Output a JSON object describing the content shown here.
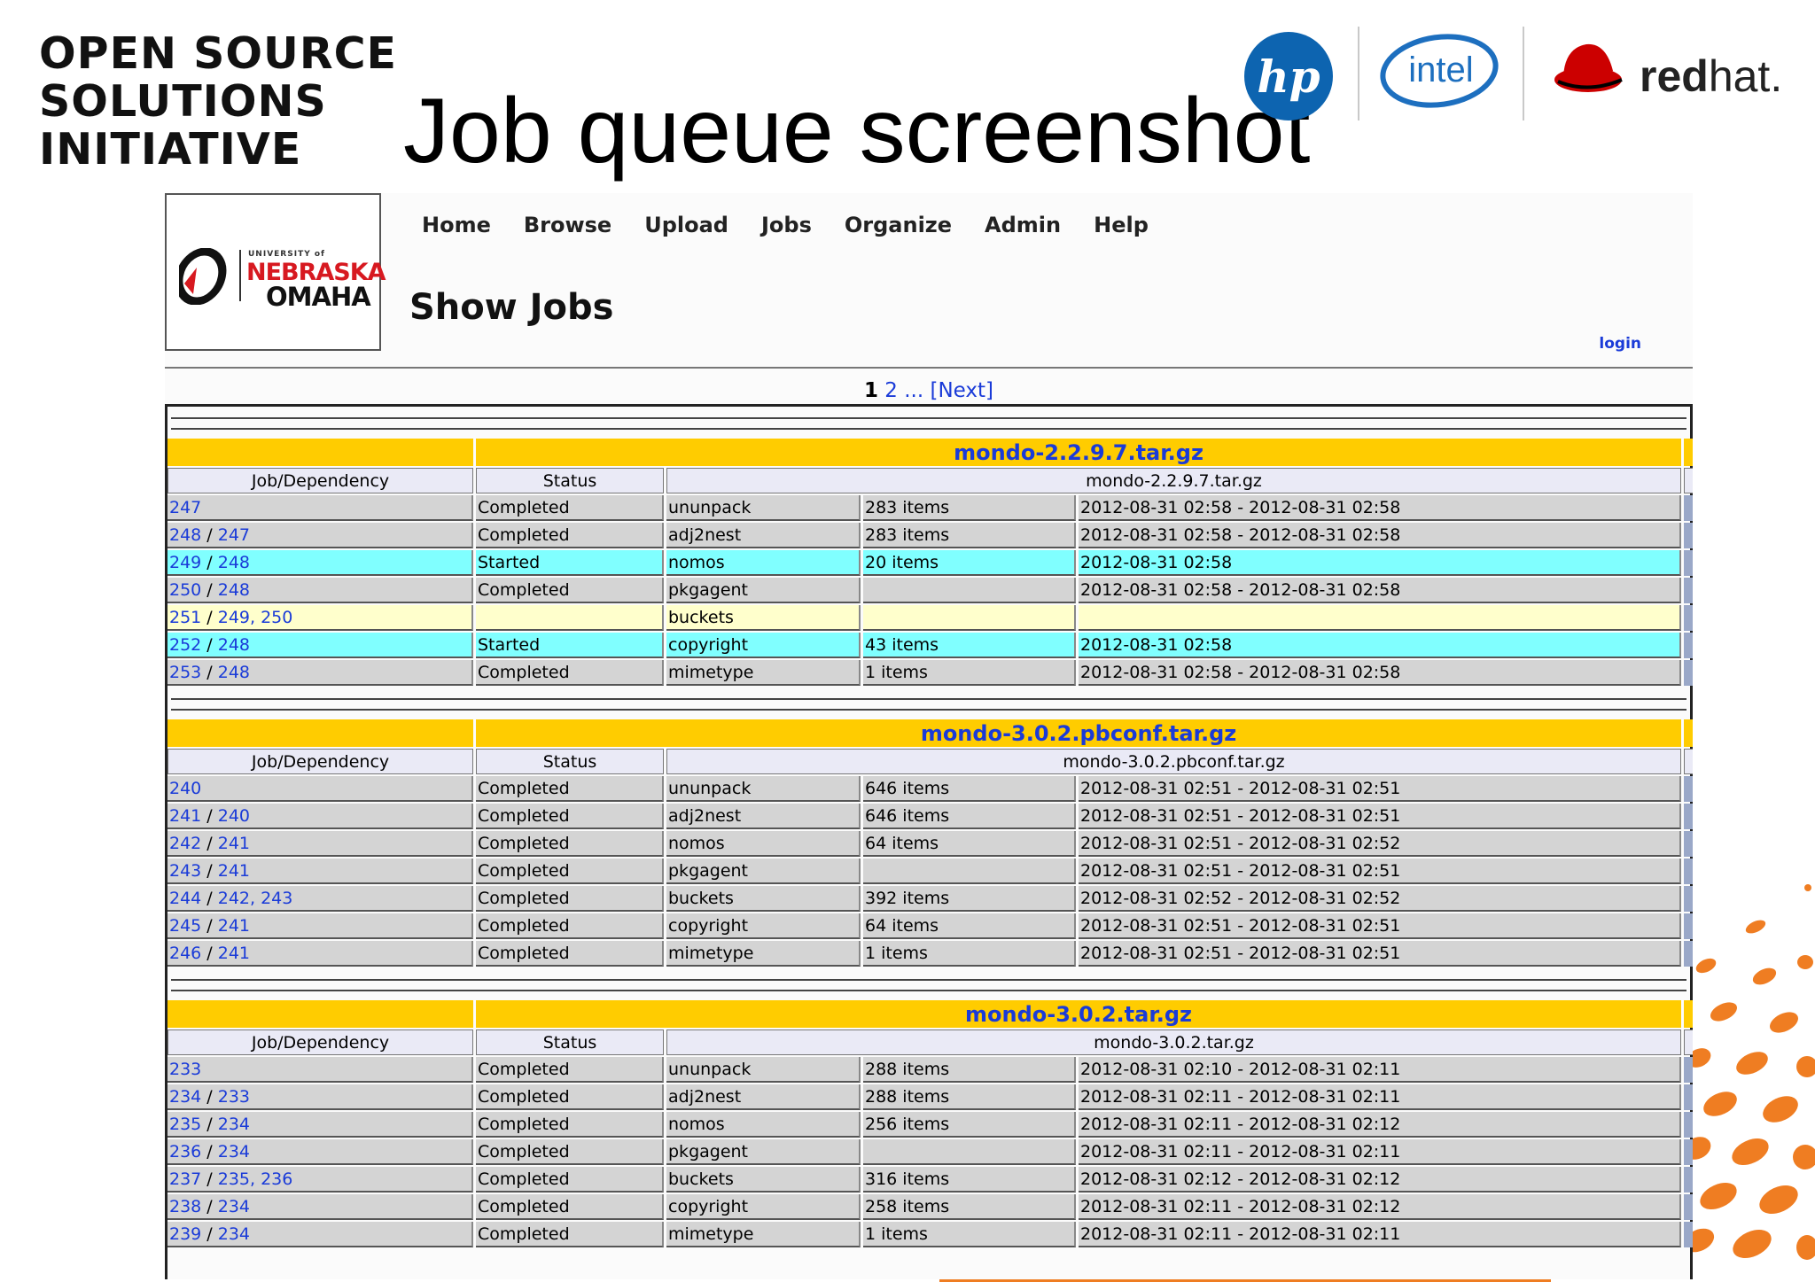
{
  "slide": {
    "org_lines": [
      "OPEN SOURCE",
      "SOLUTIONS",
      "INITIATIVE"
    ],
    "title": "Job queue screenshot",
    "sponsor_logos": [
      "hp-logo",
      "intel-logo",
      "redhat-logo"
    ],
    "hp_text": "hp",
    "intel_text": "intel",
    "redhat_text_bold": "red",
    "redhat_text_light": "hat."
  },
  "site": {
    "logo": {
      "small": "UNIVERSITY of",
      "line1": "NEBRASKA",
      "line2": "OMAHA"
    },
    "nav": [
      "Home",
      "Browse",
      "Upload",
      "Jobs",
      "Organize",
      "Admin",
      "Help"
    ],
    "heading": "Show Jobs",
    "login": "login",
    "pager": {
      "current": "1",
      "pages": [
        "2"
      ],
      "ellipsis": "...",
      "next": "[Next]"
    }
  },
  "columns": {
    "job": "Job/Dependency",
    "status": "Status"
  },
  "colors": {
    "completed": "#d4d4d4",
    "started": "#80ffff",
    "pending": "#ffffcc",
    "upload_bar": "#ffcc00"
  },
  "uploads": [
    {
      "name": "mondo-2.2.9.7.tar.gz",
      "file": "mondo-2.2.9.7.tar.gz",
      "jobs": [
        {
          "id": "247",
          "deps": "",
          "status": "Completed",
          "agent": "ununpack",
          "items": "283 items",
          "time": "2012-08-31 02:58 - 2012-08-31 02:58",
          "state": "completed"
        },
        {
          "id": "248",
          "deps": "247",
          "status": "Completed",
          "agent": "adj2nest",
          "items": "283 items",
          "time": "2012-08-31 02:58 - 2012-08-31 02:58",
          "state": "completed"
        },
        {
          "id": "249",
          "deps": "248",
          "status": "Started",
          "agent": "nomos",
          "items": "20 items",
          "time": "2012-08-31 02:58",
          "state": "started"
        },
        {
          "id": "250",
          "deps": "248",
          "status": "Completed",
          "agent": "pkgagent",
          "items": "",
          "time": "2012-08-31 02:58 - 2012-08-31 02:58",
          "state": "completed"
        },
        {
          "id": "251",
          "deps": "249, 250",
          "status": "",
          "agent": "buckets",
          "items": "",
          "time": "",
          "state": "pending"
        },
        {
          "id": "252",
          "deps": "248",
          "status": "Started",
          "agent": "copyright",
          "items": "43 items",
          "time": "2012-08-31 02:58",
          "state": "started"
        },
        {
          "id": "253",
          "deps": "248",
          "status": "Completed",
          "agent": "mimetype",
          "items": "1 items",
          "time": "2012-08-31 02:58 - 2012-08-31 02:58",
          "state": "completed"
        }
      ]
    },
    {
      "name": "mondo-3.0.2.pbconf.tar.gz",
      "file": "mondo-3.0.2.pbconf.tar.gz",
      "jobs": [
        {
          "id": "240",
          "deps": "",
          "status": "Completed",
          "agent": "ununpack",
          "items": "646 items",
          "time": "2012-08-31 02:51 - 2012-08-31 02:51",
          "state": "completed"
        },
        {
          "id": "241",
          "deps": "240",
          "status": "Completed",
          "agent": "adj2nest",
          "items": "646 items",
          "time": "2012-08-31 02:51 - 2012-08-31 02:51",
          "state": "completed"
        },
        {
          "id": "242",
          "deps": "241",
          "status": "Completed",
          "agent": "nomos",
          "items": "64 items",
          "time": "2012-08-31 02:51 - 2012-08-31 02:52",
          "state": "completed"
        },
        {
          "id": "243",
          "deps": "241",
          "status": "Completed",
          "agent": "pkgagent",
          "items": "",
          "time": "2012-08-31 02:51 - 2012-08-31 02:51",
          "state": "completed"
        },
        {
          "id": "244",
          "deps": "242, 243",
          "status": "Completed",
          "agent": "buckets",
          "items": "392 items",
          "time": "2012-08-31 02:52 - 2012-08-31 02:52",
          "state": "completed"
        },
        {
          "id": "245",
          "deps": "241",
          "status": "Completed",
          "agent": "copyright",
          "items": "64 items",
          "time": "2012-08-31 02:51 - 2012-08-31 02:51",
          "state": "completed"
        },
        {
          "id": "246",
          "deps": "241",
          "status": "Completed",
          "agent": "mimetype",
          "items": "1 items",
          "time": "2012-08-31 02:51 - 2012-08-31 02:51",
          "state": "completed"
        }
      ]
    },
    {
      "name": "mondo-3.0.2.tar.gz",
      "file": "mondo-3.0.2.tar.gz",
      "jobs": [
        {
          "id": "233",
          "deps": "",
          "status": "Completed",
          "agent": "ununpack",
          "items": "288 items",
          "time": "2012-08-31 02:10 - 2012-08-31 02:11",
          "state": "completed"
        },
        {
          "id": "234",
          "deps": "233",
          "status": "Completed",
          "agent": "adj2nest",
          "items": "288 items",
          "time": "2012-08-31 02:11 - 2012-08-31 02:11",
          "state": "completed"
        },
        {
          "id": "235",
          "deps": "234",
          "status": "Completed",
          "agent": "nomos",
          "items": "256 items",
          "time": "2012-08-31 02:11 - 2012-08-31 02:12",
          "state": "completed"
        },
        {
          "id": "236",
          "deps": "234",
          "status": "Completed",
          "agent": "pkgagent",
          "items": "",
          "time": "2012-08-31 02:11 - 2012-08-31 02:11",
          "state": "completed"
        },
        {
          "id": "237",
          "deps": "235, 236",
          "status": "Completed",
          "agent": "buckets",
          "items": "316 items",
          "time": "2012-08-31 02:12 - 2012-08-31 02:12",
          "state": "completed"
        },
        {
          "id": "238",
          "deps": "234",
          "status": "Completed",
          "agent": "copyright",
          "items": "258 items",
          "time": "2012-08-31 02:11 - 2012-08-31 02:12",
          "state": "completed"
        },
        {
          "id": "239",
          "deps": "234",
          "status": "Completed",
          "agent": "mimetype",
          "items": "1 items",
          "time": "2012-08-31 02:11 - 2012-08-31 02:11",
          "state": "completed"
        }
      ]
    }
  ]
}
